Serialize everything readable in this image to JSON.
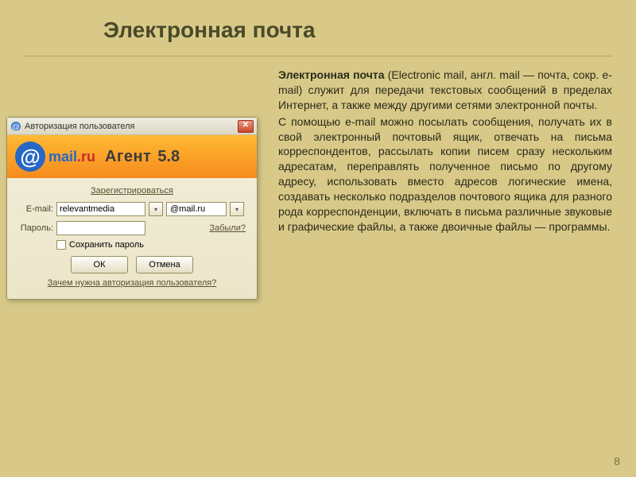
{
  "slide": {
    "title": "Электронная почта",
    "page_number": "8"
  },
  "dialog": {
    "title": "Авторизация пользователя",
    "close": "✕",
    "brand": {
      "at": "@",
      "mail": "mail",
      "dot": ".",
      "ru": "ru",
      "agent": "Агент",
      "version": "5.8"
    },
    "register_link": "Зарегистрироваться",
    "email_label": "E-mail:",
    "email_value": "relevantmedia",
    "domain_value": "@mail.ru",
    "password_label": "Пароль:",
    "password_value": "",
    "forgot_link": "Забыли?",
    "remember_label": "Сохранить пароль",
    "ok_button": "ОК",
    "cancel_button": "Отмена",
    "footer_link": "Зачем нужна авторизация пользователя?"
  },
  "text": {
    "p1_lead": "Электронная почта",
    "p1_rest": " (Electronic mail, англ. mail — почта, сокр. e-mail) служит для передачи текстовых сообщений в пределах Интернет, а также между другими сетями электронной почты.",
    "p2": "С помощью e-mail можно посылать сообщения, получать их в свой электронный почтовый ящик, отвечать на письма корреспондентов, рассылать копии писем сразу нескольким адресатам, переправлять полученное письмо по другому адресу, использовать вместо адресов логические имена, создавать несколько подразделов почтового ящика для разного рода корреспонденции, включать в письма различные звуковые и графические файлы, а также двоичные файлы — программы."
  }
}
